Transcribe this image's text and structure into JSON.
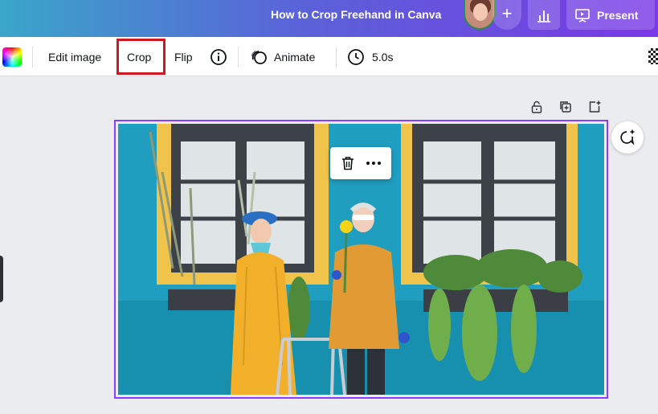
{
  "header": {
    "doc_title": "How to Crop Freehand in Canva",
    "add_collaborator_icon": "plus-icon",
    "insights_icon": "bar-chart-icon",
    "present_label": "Present",
    "present_icon": "present-screen-icon"
  },
  "toolbar": {
    "color_icon": "color-picker-icon",
    "edit_image_label": "Edit image",
    "crop_label": "Crop",
    "flip_label": "Flip",
    "info_icon": "info-icon",
    "animate_label": "Animate",
    "animate_icon": "animate-icon",
    "duration_icon": "clock-icon",
    "duration_label": "5.0s",
    "transparency_icon": "transparency-icon",
    "highlight_color": "#d0161e"
  },
  "page_tools": {
    "lock_icon": "lock-icon",
    "duplicate_icon": "duplicate-icon",
    "add_page_icon": "add-page-icon"
  },
  "canvas": {
    "comment_icon": "add-comment-icon",
    "selection_color": "#8b3dff",
    "floating_menu": {
      "delete_icon": "trash-icon",
      "more_icon": "more-icon"
    }
  }
}
